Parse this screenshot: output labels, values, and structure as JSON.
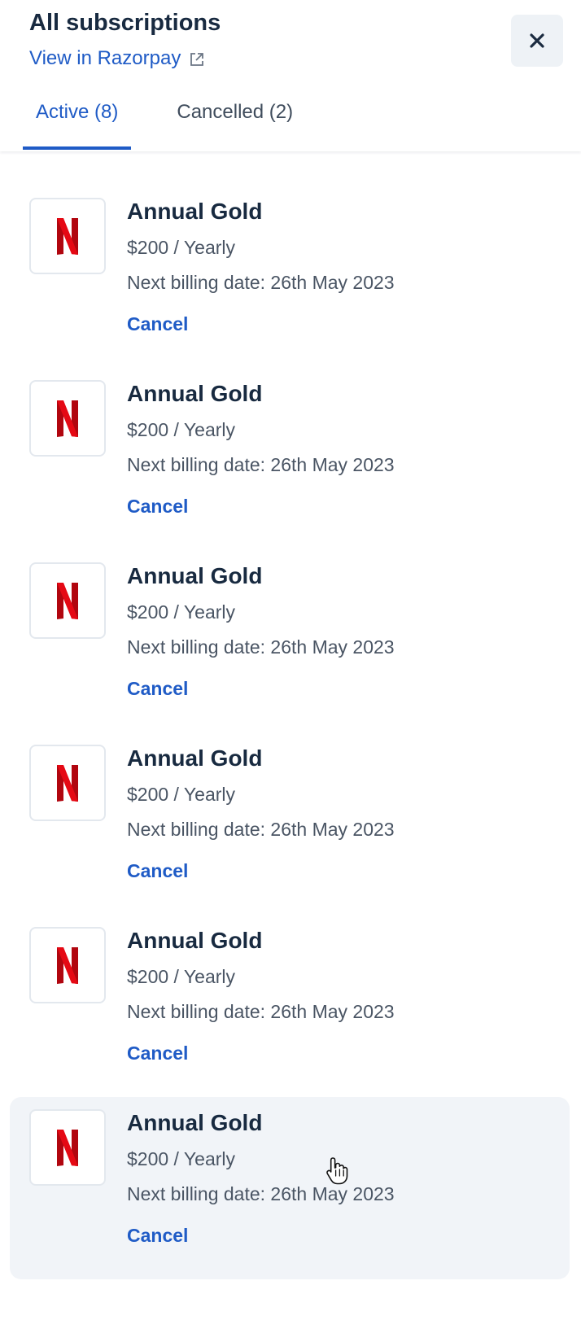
{
  "header": {
    "title": "All subscriptions",
    "view_link": "View in Razorpay",
    "external_link_icon": "external-link-icon",
    "close_icon": "close-icon"
  },
  "tabs": [
    {
      "label": "Active (8)",
      "active": true
    },
    {
      "label": "Cancelled (2)",
      "active": false
    }
  ],
  "subscriptions": [
    {
      "logo": "netflix-logo-icon",
      "plan": "Annual Gold",
      "price": "$200 / Yearly",
      "next_billing": "Next billing date: 26th May 2023",
      "cancel_label": "Cancel"
    },
    {
      "logo": "netflix-logo-icon",
      "plan": "Annual Gold",
      "price": "$200 / Yearly",
      "next_billing": "Next billing date: 26th May 2023",
      "cancel_label": "Cancel"
    },
    {
      "logo": "netflix-logo-icon",
      "plan": "Annual Gold",
      "price": "$200 / Yearly",
      "next_billing": "Next billing date: 26th May 2023",
      "cancel_label": "Cancel"
    },
    {
      "logo": "netflix-logo-icon",
      "plan": "Annual Gold",
      "price": "$200 / Yearly",
      "next_billing": "Next billing date: 26th May 2023",
      "cancel_label": "Cancel"
    },
    {
      "logo": "netflix-logo-icon",
      "plan": "Annual Gold",
      "price": "$200 / Yearly",
      "next_billing": "Next billing date: 26th May 2023",
      "cancel_label": "Cancel"
    },
    {
      "logo": "netflix-logo-icon",
      "plan": "Annual Gold",
      "price": "$200 / Yearly",
      "next_billing": "Next billing date: 26th May 2023",
      "cancel_label": "Cancel"
    }
  ],
  "colors": {
    "accent": "#1f5bc6",
    "text_primary": "#182a40",
    "text_secondary": "#4a5564",
    "hover_bg": "#f1f4f8",
    "logo_red": "#e50914"
  }
}
